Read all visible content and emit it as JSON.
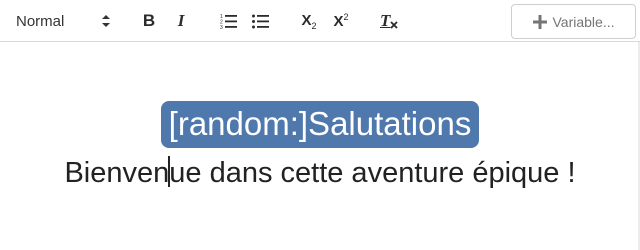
{
  "toolbar": {
    "format_select": {
      "value": "Normal",
      "icon": "select-arrows-icon"
    },
    "buttons": [
      {
        "name": "bold",
        "label": "B",
        "icon": "bold-icon"
      },
      {
        "name": "italic",
        "label": "I",
        "icon": "italic-icon"
      },
      {
        "name": "ordered-list",
        "icon": "ordered-list-icon"
      },
      {
        "name": "bullet-list",
        "icon": "bullet-list-icon"
      },
      {
        "name": "subscript",
        "label": "X",
        "sub": "2",
        "icon": "subscript-icon"
      },
      {
        "name": "superscript",
        "label": "X",
        "sup": "2",
        "icon": "superscript-icon"
      },
      {
        "name": "clear-format",
        "label": "T",
        "icon": "clear-format-icon"
      }
    ],
    "variable_button": {
      "label": "Variable...",
      "icon": "plus-icon"
    }
  },
  "editor": {
    "variable_tag": "[random:]Salutations",
    "text_before_caret": "Bienven",
    "text_after_caret": "ue dans cette aventure épique !"
  },
  "colors": {
    "tag_background": "#4f78ad",
    "tag_text": "#ffffff",
    "toolbar_border": "#d9d9d9",
    "text": "#222222"
  }
}
